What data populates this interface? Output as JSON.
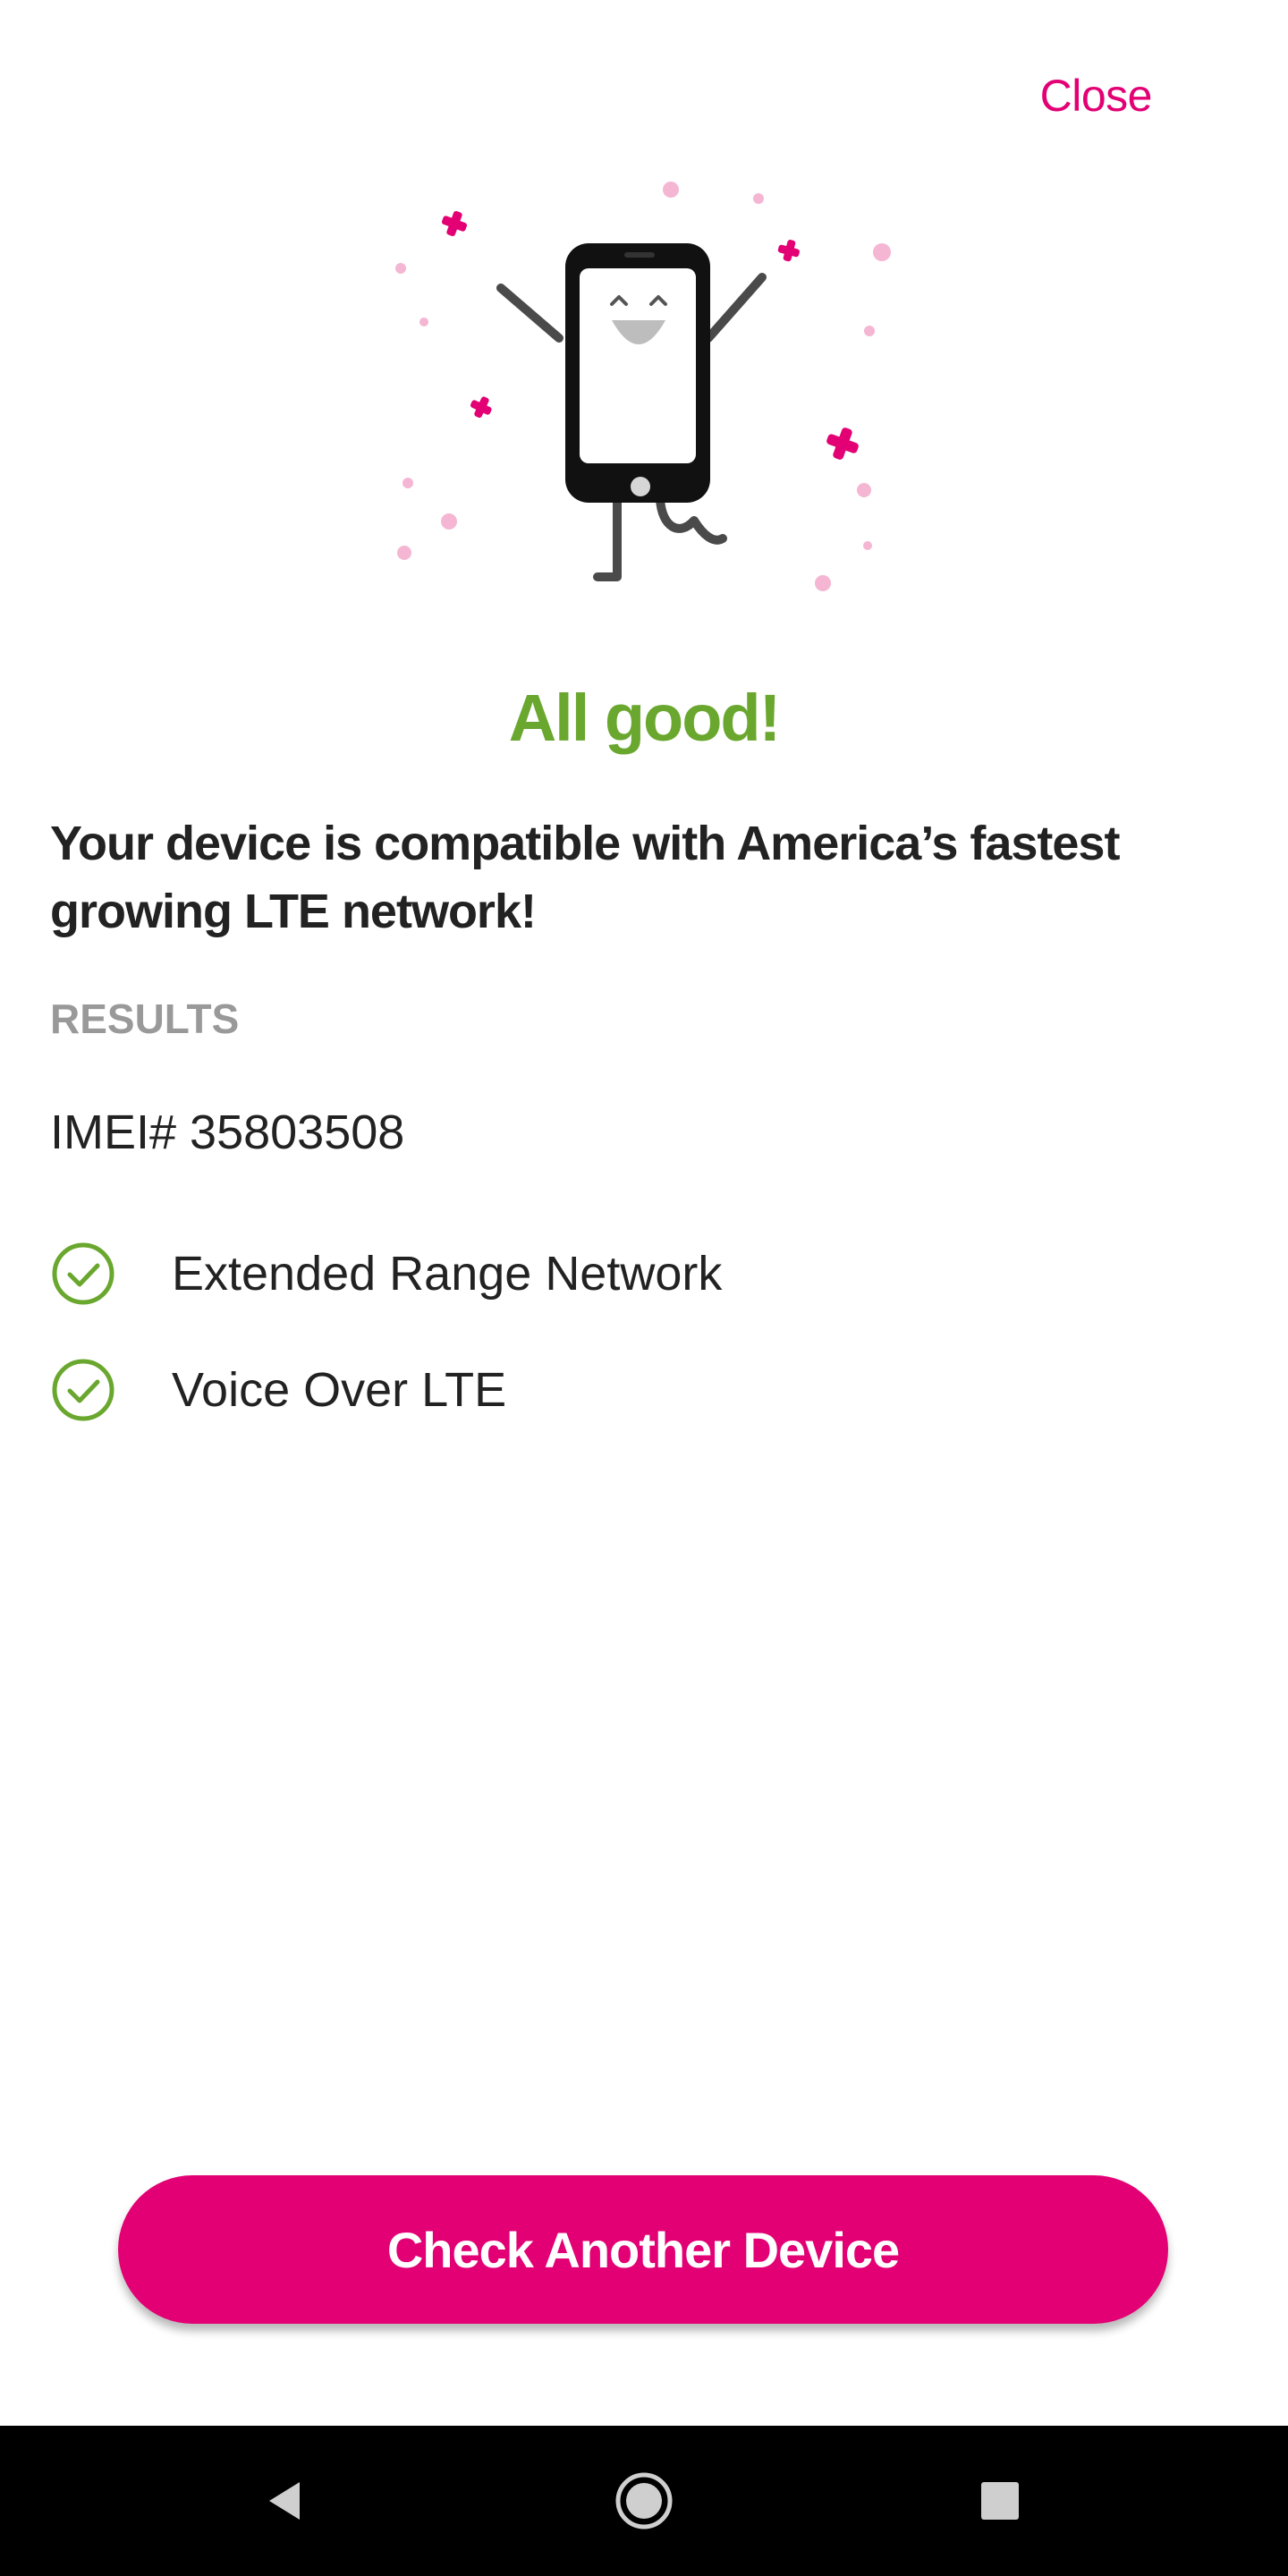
{
  "header": {
    "close_label": "Close"
  },
  "result": {
    "headline": "All good!",
    "message": "Your device is compatible with America’s fastest growing LTE network!",
    "section_label": "RESULTS",
    "imei": "IMEI# 35803508",
    "features": [
      {
        "label": "Extended Range Network",
        "icon": "check-circle-icon",
        "status": "supported"
      },
      {
        "label": "Voice Over LTE",
        "icon": "check-circle-icon",
        "status": "supported"
      }
    ]
  },
  "actions": {
    "check_another_label": "Check Another Device"
  },
  "navigation": {
    "buttons": [
      "back-icon",
      "home-icon",
      "recents-icon"
    ]
  },
  "colors": {
    "brand_magenta": "#e20074",
    "success_green": "#6aa72e",
    "text_dark": "#222222",
    "label_gray": "#999999"
  }
}
